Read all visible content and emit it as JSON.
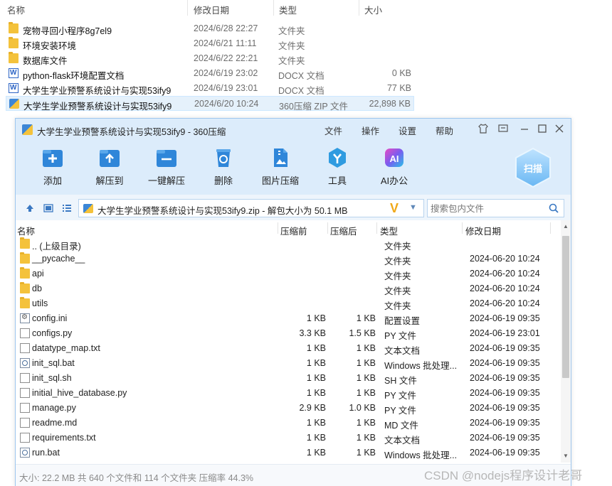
{
  "explorer": {
    "columns": [
      "名称",
      "修改日期",
      "类型",
      "大小"
    ],
    "rows": [
      {
        "name": "宠物寻回小程序8g7el9",
        "date": "2024/6/28 22:27",
        "type": "文件夹",
        "size": "",
        "icon": "folder-icon"
      },
      {
        "name": "环境安装环境",
        "date": "2024/6/21 11:11",
        "type": "文件夹",
        "size": "",
        "icon": "folder-icon"
      },
      {
        "name": "数据库文件",
        "date": "2024/6/22 22:21",
        "type": "文件夹",
        "size": "",
        "icon": "folder-icon"
      },
      {
        "name": "python-flask环境配置文档",
        "date": "2024/6/19 23:02",
        "type": "DOCX 文档",
        "size": "0 KB",
        "icon": "docx-icon"
      },
      {
        "name": "大学生学业预警系统设计与实现53ify9",
        "date": "2024/6/19 23:01",
        "type": "DOCX 文档",
        "size": "77 KB",
        "icon": "docx-icon"
      },
      {
        "name": "大学生学业预警系统设计与实现53ify9",
        "date": "2024/6/20 10:24",
        "type": "360压缩 ZIP 文件",
        "size": "22,898 KB",
        "icon": "zip-icon",
        "selected": true
      }
    ]
  },
  "window": {
    "title": "大学生学业预警系统设计与实现53ify9 - 360压缩",
    "menu": [
      "文件",
      "操作",
      "设置",
      "帮助"
    ],
    "toolbar": [
      "添加",
      "解压到",
      "一键解压",
      "删除",
      "图片压缩",
      "工具",
      "AI办公"
    ],
    "scan_label": "扫描",
    "address": "大学生学业预警系统设计与实现53ify9.zip - 解包大小为 50.1 MB",
    "search_placeholder": "搜索包内文件",
    "columns": {
      "name": "名称",
      "before": "压缩前",
      "after": "压缩后",
      "type": "类型",
      "date": "修改日期"
    },
    "files": [
      {
        "name": ".. (上级目录)",
        "before": "",
        "after": "",
        "type": "文件夹",
        "date": "",
        "icon": "folder-icon"
      },
      {
        "name": "__pycache__",
        "before": "",
        "after": "",
        "type": "文件夹",
        "date": "2024-06-20 10:24",
        "icon": "folder-icon"
      },
      {
        "name": "api",
        "before": "",
        "after": "",
        "type": "文件夹",
        "date": "2024-06-20 10:24",
        "icon": "folder-icon"
      },
      {
        "name": "db",
        "before": "",
        "after": "",
        "type": "文件夹",
        "date": "2024-06-20 10:24",
        "icon": "folder-icon"
      },
      {
        "name": "utils",
        "before": "",
        "after": "",
        "type": "文件夹",
        "date": "2024-06-20 10:24",
        "icon": "folder-icon"
      },
      {
        "name": "config.ini",
        "before": "1 KB",
        "after": "1 KB",
        "type": "配置设置",
        "date": "2024-06-19 09:35",
        "icon": "settings-file-icon"
      },
      {
        "name": "configs.py",
        "before": "3.3 KB",
        "after": "1.5 KB",
        "type": "PY 文件",
        "date": "2024-06-19 23:01",
        "icon": "file-icon"
      },
      {
        "name": "datatype_map.txt",
        "before": "1 KB",
        "after": "1 KB",
        "type": "文本文档",
        "date": "2024-06-19 09:35",
        "icon": "file-icon"
      },
      {
        "name": "init_sql.bat",
        "before": "1 KB",
        "after": "1 KB",
        "type": "Windows 批处理...",
        "date": "2024-06-19 09:35",
        "icon": "batch-file-icon"
      },
      {
        "name": "init_sql.sh",
        "before": "1 KB",
        "after": "1 KB",
        "type": "SH 文件",
        "date": "2024-06-19 09:35",
        "icon": "file-icon"
      },
      {
        "name": "initial_hive_database.py",
        "before": "1 KB",
        "after": "1 KB",
        "type": "PY 文件",
        "date": "2024-06-19 09:35",
        "icon": "file-icon"
      },
      {
        "name": "manage.py",
        "before": "2.9 KB",
        "after": "1.0 KB",
        "type": "PY 文件",
        "date": "2024-06-19 09:35",
        "icon": "file-icon"
      },
      {
        "name": "readme.md",
        "before": "1 KB",
        "after": "1 KB",
        "type": "MD 文件",
        "date": "2024-06-19 09:35",
        "icon": "file-icon"
      },
      {
        "name": "requirements.txt",
        "before": "1 KB",
        "after": "1 KB",
        "type": "文本文档",
        "date": "2024-06-19 09:35",
        "icon": "file-icon"
      },
      {
        "name": "run.bat",
        "before": "1 KB",
        "after": "1 KB",
        "type": "Windows 批处理...",
        "date": "2024-06-19 09:35",
        "icon": "batch-file-icon"
      }
    ],
    "status": "大小: 22.2 MB 共 640 个文件和 114 个文件夹 压缩率 44.3%"
  },
  "watermark": "CSDN @nodejs程序设计老哥"
}
